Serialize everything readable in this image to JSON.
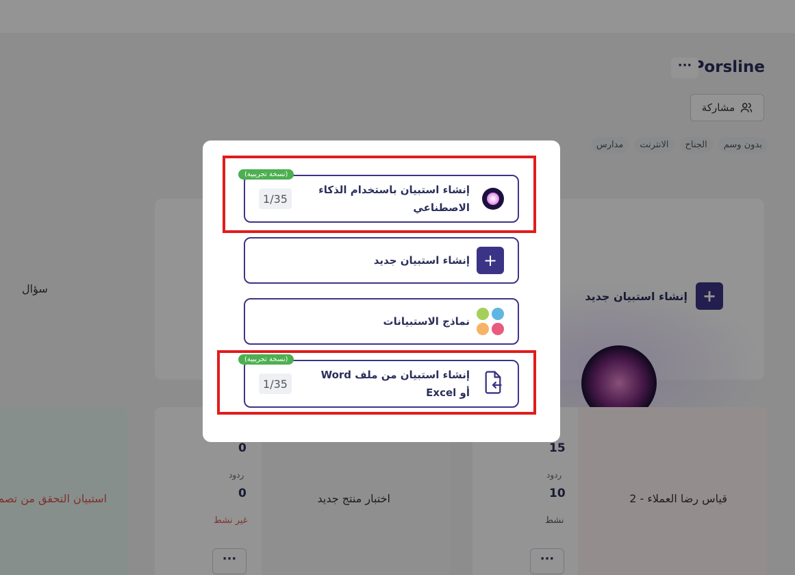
{
  "app": {
    "title": "Porsline",
    "more_label": "···",
    "share_label": "مشاركة"
  },
  "tags": [
    "بدون وسم",
    "الجناح",
    "الانترنت",
    "مدارس"
  ],
  "background": {
    "new_survey_label": "إنشاء استبيان جديد",
    "question_label": "سؤال"
  },
  "surveys": [
    {
      "name": "قياس رضا العملاء - 2",
      "views": "15",
      "responses_label": "ردود",
      "responses": "10",
      "status": "نشط",
      "status_color": "#555555"
    },
    {
      "name": "اختبار منتج جديد",
      "views": "0",
      "responses_label": "ردود",
      "responses": "0",
      "status": "غير نشط",
      "status_color": "#d9534f"
    },
    {
      "name": "استبيان التحقق من تصم",
      "status_color": "#d9534f"
    }
  ],
  "modal": {
    "options": [
      {
        "label": "إنشاء استبيان باستخدام الذكاء الاصطناعي",
        "badge": "(نسخة تجريبية)",
        "counter": "1/35",
        "icon": "ai-orb-icon"
      },
      {
        "label": "إنشاء استبيان جديد",
        "icon": "plus-icon"
      },
      {
        "label": "نماذج الاستبيانات",
        "icon": "templates-grid-icon"
      },
      {
        "label": "إنشاء استبيان من ملف Word أو Excel",
        "badge": "(نسخة تجريبية)",
        "counter": "1/35",
        "icon": "file-import-icon"
      }
    ]
  },
  "colors": {
    "primary": "#3b3486",
    "badge": "#4caf50",
    "highlight": "#e01c1c",
    "template_dots": [
      "#5fb6e0",
      "#a6cf5a",
      "#e95a7d",
      "#f7b267"
    ]
  }
}
